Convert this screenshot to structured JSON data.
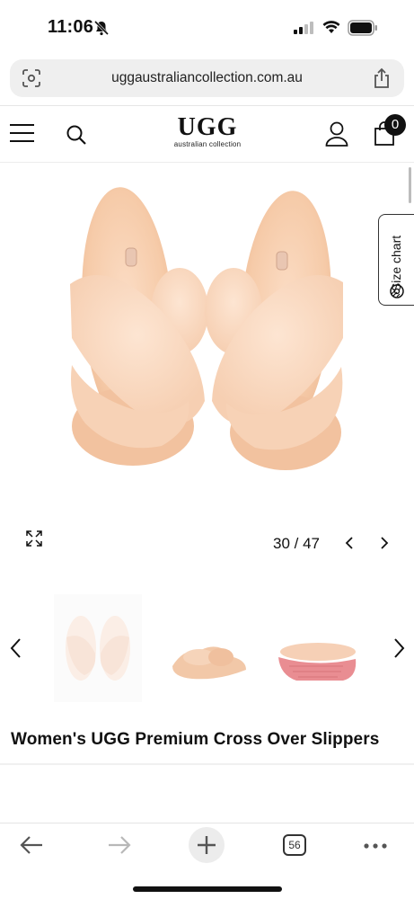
{
  "status_bar": {
    "time": "11:06"
  },
  "browser": {
    "url": "uggaustraliancollection.com.au"
  },
  "header": {
    "logo_main": "UGG",
    "logo_sub": "australian collection",
    "cart_count": "0"
  },
  "gallery": {
    "size_chart_label": "Size chart",
    "counter": "30 / 47"
  },
  "product": {
    "title": "Women's UGG Premium Cross Over Slippers"
  },
  "toolbar": {
    "tabs_count": "56"
  },
  "colors": {
    "fur": "#f6ccaf",
    "sole": "#e98d92",
    "accent": "#111111"
  }
}
